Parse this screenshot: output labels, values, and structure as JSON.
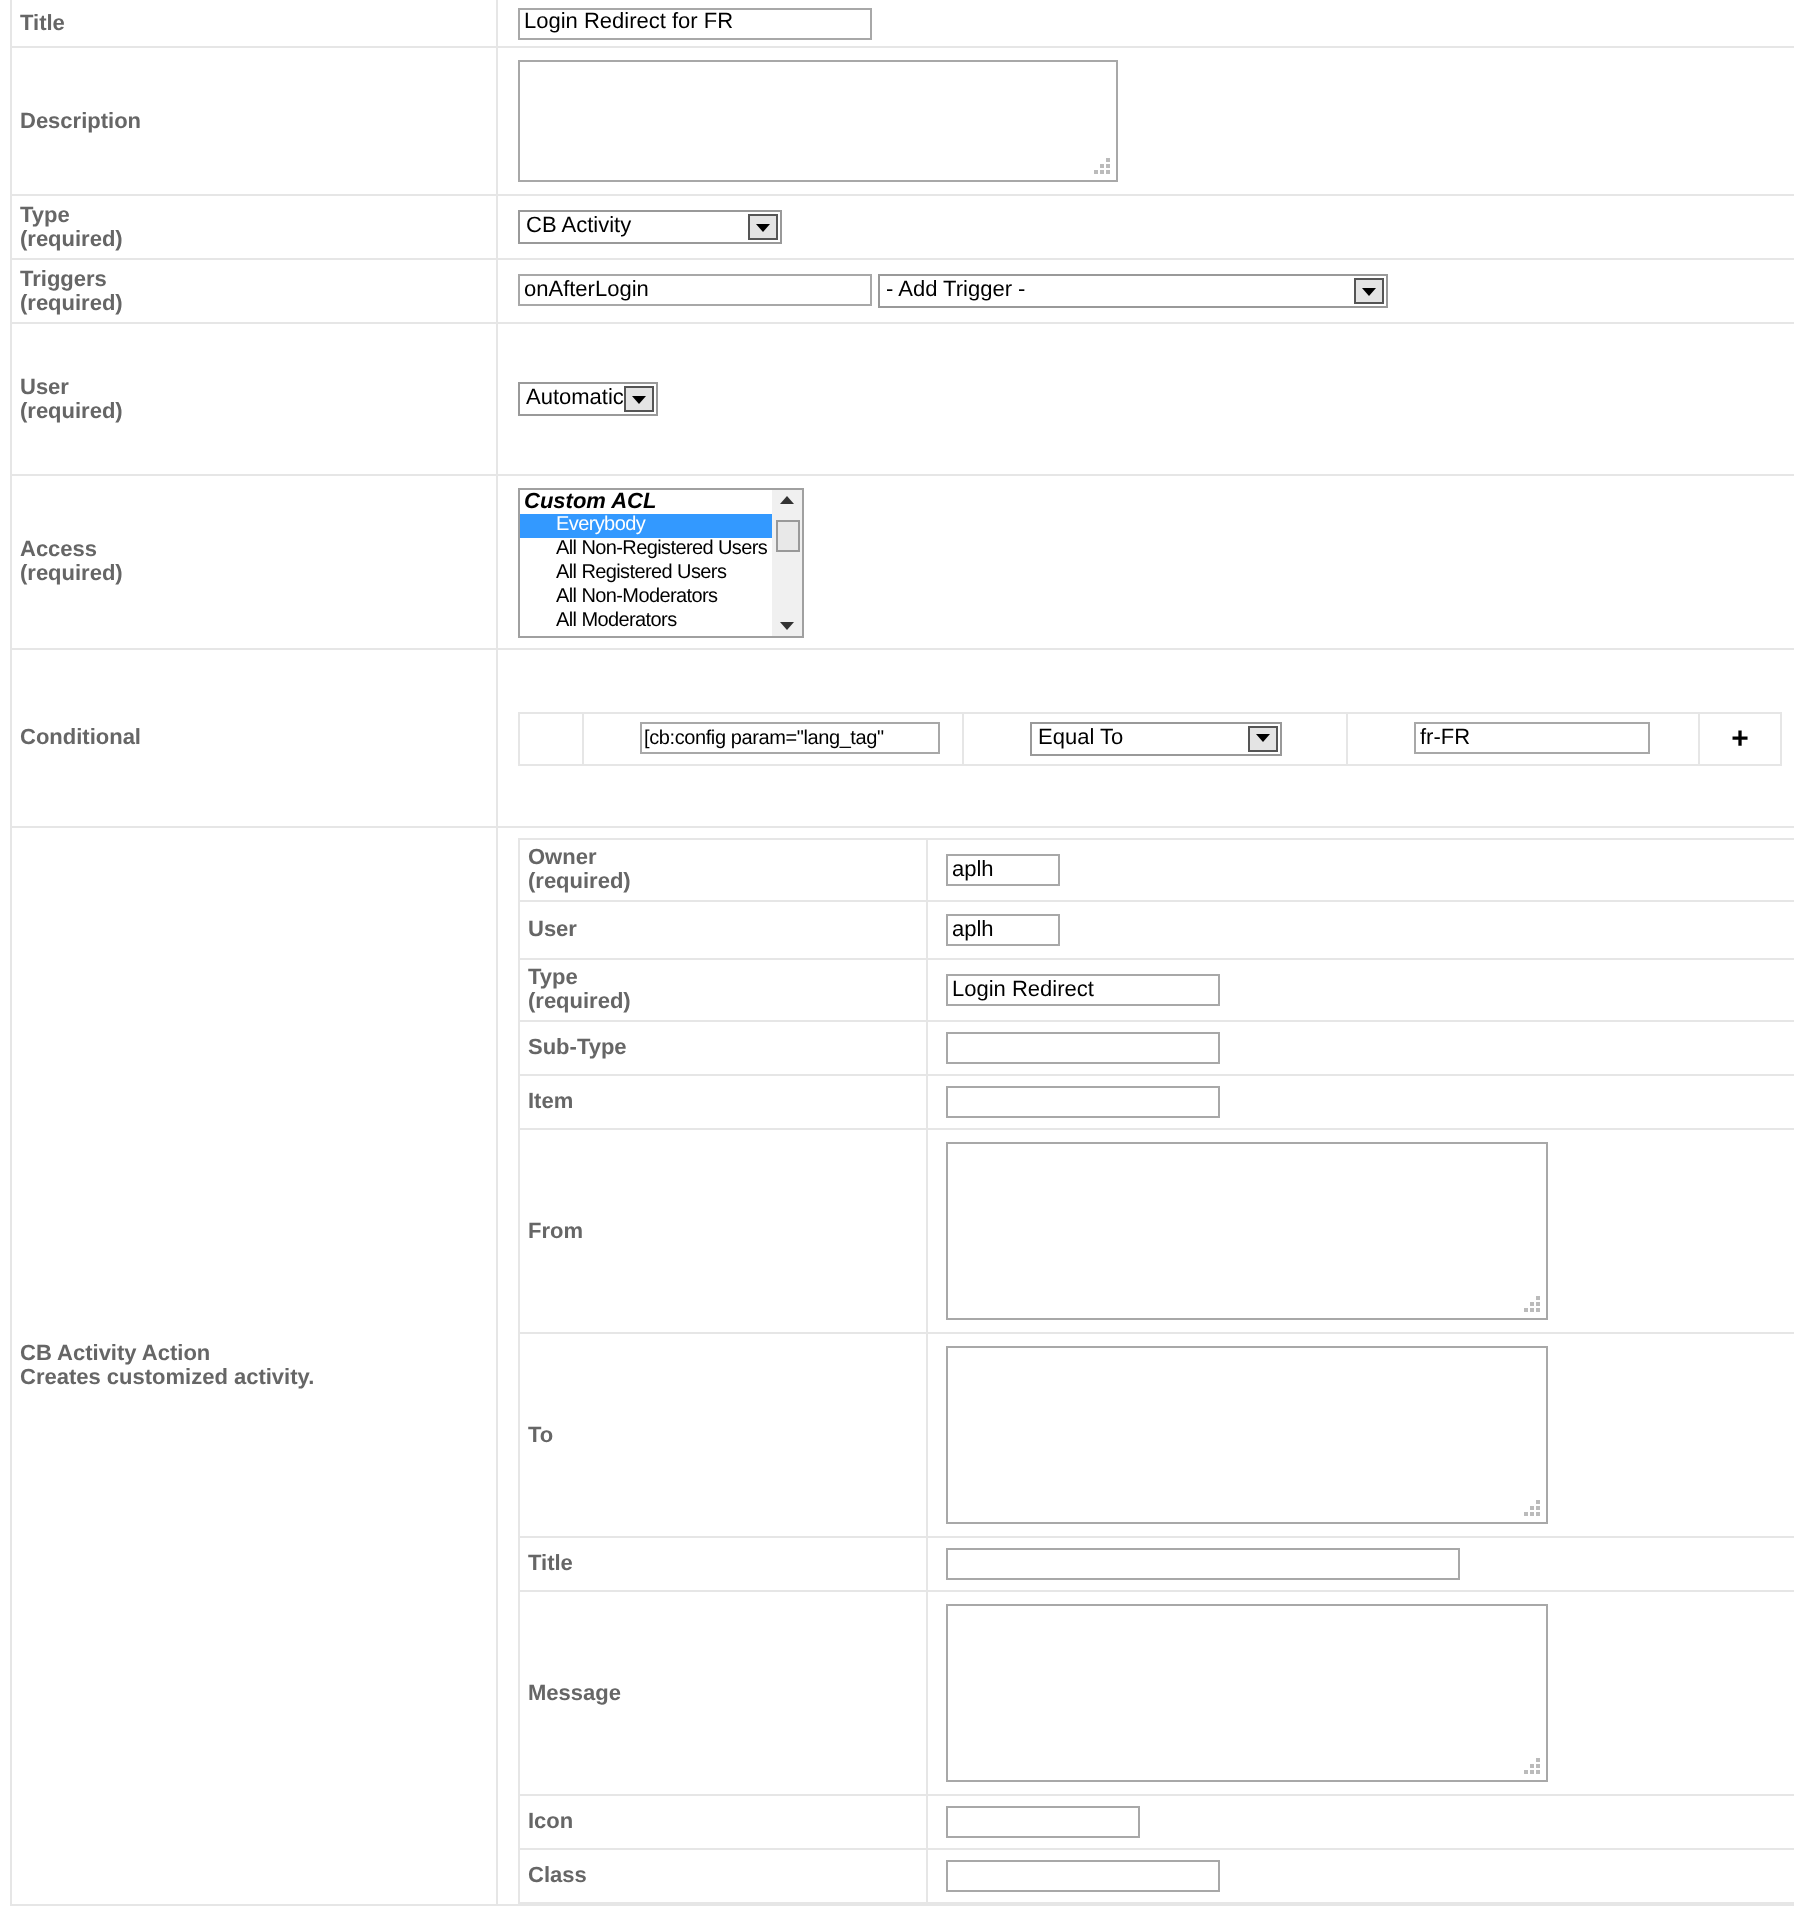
{
  "rows": [
    {
      "label": "Title",
      "kind": "text",
      "value": "Login Redirect for FR"
    },
    {
      "label": "Description",
      "kind": "textarea",
      "value": ""
    },
    {
      "label": "Type",
      "note": "(required)",
      "kind": "select",
      "value": "CB Activity"
    },
    {
      "label": "Triggers",
      "note": "(required)",
      "kind": "triggers",
      "value": "onAfterLogin",
      "select": "- Add Trigger -"
    },
    {
      "label": "User",
      "note": "(required)",
      "kind": "select",
      "value": "Automatic"
    },
    {
      "label": "Access",
      "note": "(required)",
      "kind": "listbox",
      "group": "Custom ACL",
      "options": [
        {
          "label": "Everybody",
          "selected": true
        },
        {
          "label": "All Non-Registered Users",
          "selected": false
        },
        {
          "label": "All Registered Users",
          "selected": false
        },
        {
          "label": "All Non-Moderators",
          "selected": false
        },
        {
          "label": "All Moderators",
          "selected": false
        }
      ]
    },
    {
      "label": "Conditional",
      "kind": "conditional",
      "field": "[cb:config param=\"lang_tag\"",
      "operator": "Equal To",
      "value": "fr-FR",
      "add": "+"
    },
    {
      "label": "CB Activity Action",
      "note": "Creates customized activity.",
      "kind": "nested",
      "rows": [
        {
          "label": "Owner",
          "note": "(required)",
          "kind": "text",
          "value": "aplh"
        },
        {
          "label": "User",
          "kind": "text",
          "value": "aplh"
        },
        {
          "label": "Type",
          "note": "(required)",
          "kind": "text",
          "value": "Login Redirect"
        },
        {
          "label": "Sub-Type",
          "kind": "text",
          "value": ""
        },
        {
          "label": "Item",
          "kind": "text",
          "value": ""
        },
        {
          "label": "From",
          "kind": "textarea",
          "value": ""
        },
        {
          "label": "To",
          "kind": "textarea",
          "value": ""
        },
        {
          "label": "Title",
          "kind": "text",
          "value": ""
        },
        {
          "label": "Message",
          "kind": "textarea",
          "value": ""
        },
        {
          "label": "Icon",
          "kind": "text",
          "value": ""
        },
        {
          "label": "Class",
          "kind": "text",
          "value": ""
        }
      ]
    }
  ]
}
